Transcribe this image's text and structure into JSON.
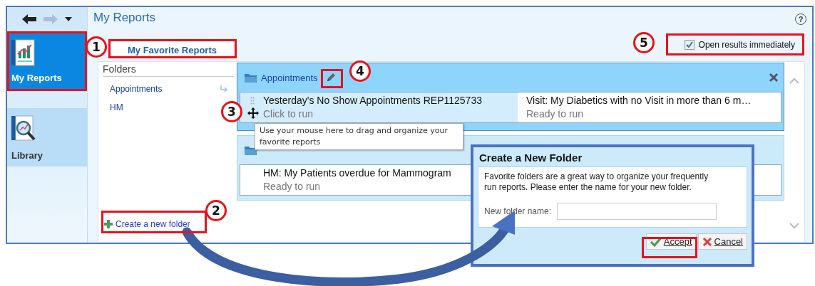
{
  "nav": {
    "items": [
      {
        "label": "My Reports",
        "kind": "reports",
        "selected": true
      },
      {
        "label": "Library",
        "kind": "library",
        "selected": false
      }
    ]
  },
  "header": {
    "title": "My Reports",
    "help": "?"
  },
  "tabs": [
    {
      "label": "My Favorite Reports",
      "selected": true
    }
  ],
  "open_results": {
    "label": "Open results immediately",
    "checked": true
  },
  "folders": {
    "title": "Folders",
    "items": [
      {
        "label": "Appointments",
        "drop_hint": true
      },
      {
        "label": "HM",
        "drop_hint": false
      }
    ],
    "create_link": "Create a new folder"
  },
  "groups": [
    {
      "name": "Appointments",
      "active": true,
      "reports": [
        {
          "title": "Yesterday's No Show Appointments REP1125733",
          "status": "Click to run",
          "hover": true
        },
        {
          "title": "Visit: My Diabetics with no Visit in more than 6 m…",
          "status": "Ready to run",
          "hover": false
        }
      ]
    },
    {
      "active": false,
      "reports": [
        {
          "title": "HM: My Patients overdue for Mammogram",
          "status": "Ready to run",
          "hover": false
        }
      ]
    }
  ],
  "tooltip": "Use your mouse here to drag and organize your favorite reports",
  "dialog": {
    "title": "Create a New Folder",
    "message": "Favorite folders are a great way to organize your frequently run reports. Please enter the name for your new folder.",
    "field_label": "New folder name:",
    "buttons": [
      {
        "label": "Accept",
        "kind": "accept"
      },
      {
        "label": "Cancel",
        "kind": "cancel"
      }
    ]
  },
  "callouts": [
    "1",
    "2",
    "3",
    "4",
    "5"
  ]
}
